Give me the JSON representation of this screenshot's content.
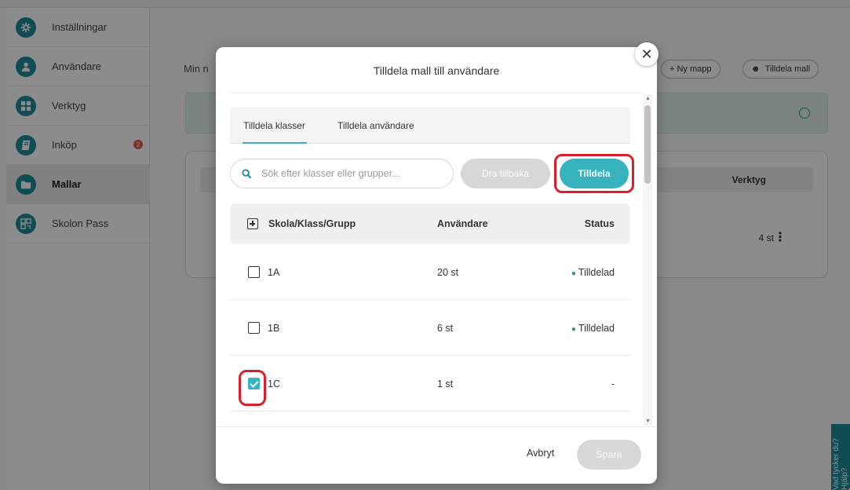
{
  "sidebar": {
    "items": [
      {
        "label": "Inställningar",
        "icon": "gear-icon"
      },
      {
        "label": "Användare",
        "icon": "user-icon"
      },
      {
        "label": "Verktyg",
        "icon": "grid-icon"
      },
      {
        "label": "Inköp",
        "icon": "book-icon",
        "badge": "2"
      },
      {
        "label": "Mallar",
        "icon": "folder-icon",
        "active": true
      },
      {
        "label": "Skolon Pass",
        "icon": "qr-code-icon"
      }
    ]
  },
  "background": {
    "breadcrumb": "Min n",
    "new_folder_label": "+ Ny mapp",
    "assign_template_label": "Tilldela mall",
    "table_header_tools": "Verktyg",
    "row_count": "4 st",
    "feedback_tab": "Vad tycker du? Hjälp?"
  },
  "modal": {
    "title": "Tilldela mall till användare",
    "close_symbol": "✕",
    "tabs": [
      {
        "label": "Tilldela klasser",
        "active": true
      },
      {
        "label": "Tilldela användare",
        "active": false
      }
    ],
    "search": {
      "placeholder": "Sök efter klasser eller grupper..."
    },
    "undo_label": "Dra tillbaka",
    "assign_label": "Tilldela",
    "table": {
      "headers": {
        "group": "Skola/Klass/Grupp",
        "users": "Användare",
        "status": "Status"
      },
      "rows": [
        {
          "name": "1A",
          "users": "20 st",
          "status": "Tilldelad",
          "checked": false
        },
        {
          "name": "1B",
          "users": "6 st",
          "status": "Tilldelad",
          "checked": false
        },
        {
          "name": "1C",
          "users": "1 st",
          "status": "-",
          "checked": true
        }
      ]
    },
    "cancel_label": "Avbryt",
    "save_label": "Spara"
  },
  "colors": {
    "accent": "#36b3bf",
    "sidebar_icon": "#1d8a99",
    "highlight": "#d9202a",
    "status_ok": "#2d9a68"
  }
}
